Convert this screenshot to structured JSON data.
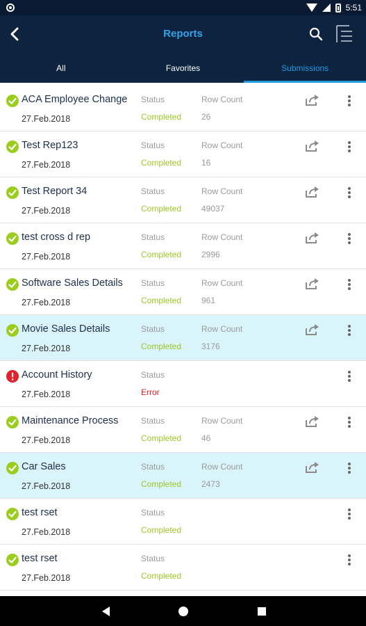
{
  "status_bar": {
    "time": "5:51"
  },
  "header": {
    "title": "Reports"
  },
  "tabs": [
    {
      "label": "All",
      "active": false
    },
    {
      "label": "Favorites",
      "active": false
    },
    {
      "label": "Submissions",
      "active": true
    }
  ],
  "labels": {
    "status": "Status",
    "row_count": "Row Count"
  },
  "colors": {
    "header_bg": "#0e2340",
    "accent": "#1f9ae0",
    "completed": "#9ec726",
    "error": "#e0222b",
    "highlight": "#d9f4fa"
  },
  "icons": {
    "back": "arrow-left-icon",
    "search": "search-icon",
    "menu": "menu-icon",
    "completed": "check-circle-icon",
    "error": "error-circle-icon",
    "share": "share-icon",
    "more": "more-vertical-icon"
  },
  "reports": [
    {
      "name": "ACA Employee Change",
      "date": "27.Feb.2018",
      "status": "Completed",
      "row_count": "26",
      "shareable": true,
      "highlighted": false
    },
    {
      "name": "Test Rep123",
      "date": "27.Feb.2018",
      "status": "Completed",
      "row_count": "16",
      "shareable": true,
      "highlighted": false
    },
    {
      "name": "Test Report 34",
      "date": "27.Feb.2018",
      "status": "Completed",
      "row_count": "49037",
      "shareable": true,
      "highlighted": false
    },
    {
      "name": "test cross d rep",
      "date": "27.Feb.2018",
      "status": "Completed",
      "row_count": "2996",
      "shareable": true,
      "highlighted": false
    },
    {
      "name": "Software Sales Details",
      "date": "27.Feb.2018",
      "status": "Completed",
      "row_count": "961",
      "shareable": true,
      "highlighted": false
    },
    {
      "name": "Movie Sales Details",
      "date": "27.Feb.2018",
      "status": "Completed",
      "row_count": "3176",
      "shareable": true,
      "highlighted": true
    },
    {
      "name": "Account History",
      "date": "27.Feb.2018",
      "status": "Error",
      "row_count": "",
      "shareable": false,
      "highlighted": false
    },
    {
      "name": "Maintenance Process",
      "date": "27.Feb.2018",
      "status": "Completed",
      "row_count": "46",
      "shareable": true,
      "highlighted": false
    },
    {
      "name": "Car Sales",
      "date": "27.Feb.2018",
      "status": "Completed",
      "row_count": "2473",
      "shareable": true,
      "highlighted": true
    },
    {
      "name": "test rset",
      "date": "27.Feb.2018",
      "status": "Completed",
      "row_count": "",
      "shareable": false,
      "highlighted": false
    },
    {
      "name": "test rset",
      "date": "27.Feb.2018",
      "status": "Completed",
      "row_count": "",
      "shareable": false,
      "highlighted": false
    }
  ]
}
